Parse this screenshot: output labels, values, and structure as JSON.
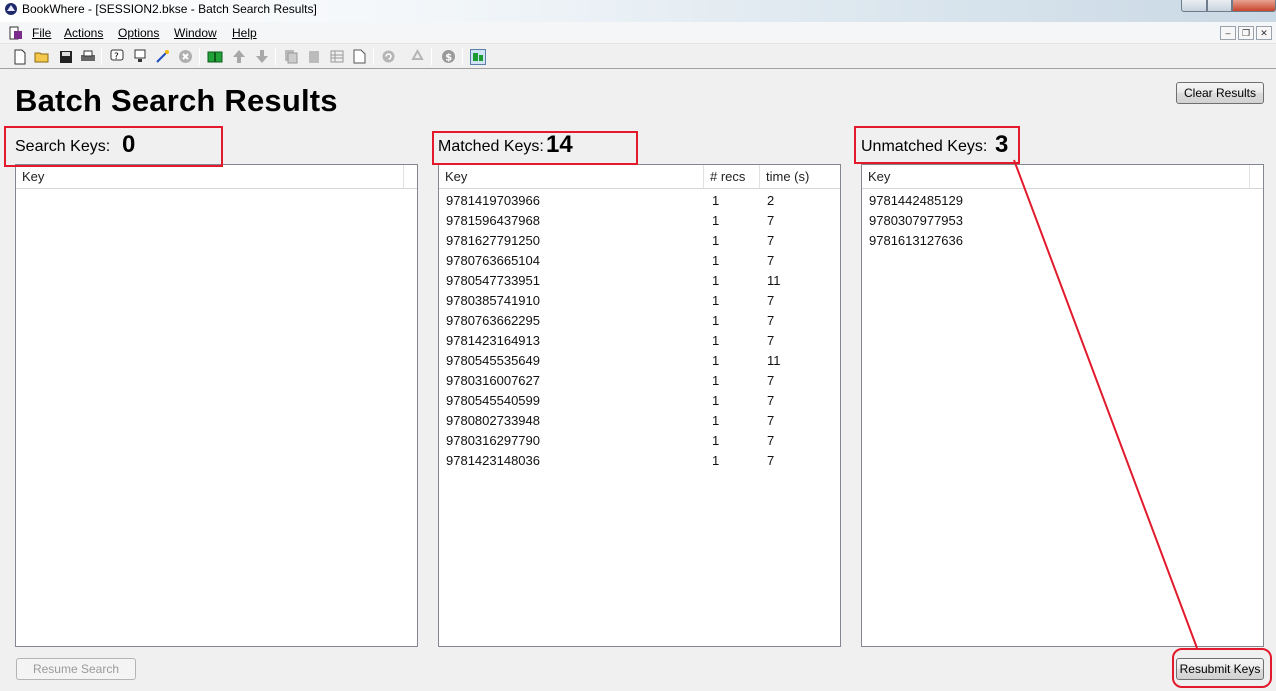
{
  "window": {
    "title": "BookWhere - [SESSION2.bkse - Batch Search Results]"
  },
  "menu": [
    "File",
    "Actions",
    "Options",
    "Window",
    "Help"
  ],
  "toolbar_icons": [
    "new-document-icon",
    "open-folder-icon",
    "save-disk-icon",
    "print-icon",
    "query-icon",
    "connect-icon",
    "wizard-icon",
    "stop-icon",
    "book-green-icon",
    "arrow-up-icon",
    "arrow-down-icon",
    "copy-record-icon",
    "paste-record-icon",
    "table-icon",
    "page-icon",
    "refresh-icon",
    "recycle-icon",
    "dollar-icon",
    "batch-search-icon"
  ],
  "page": {
    "title": "Batch Search Results",
    "clear_results_label": "Clear Results",
    "resume_search_label": "Resume Search",
    "resubmit_keys_label": "Resubmit Keys"
  },
  "search_keys": {
    "label": "Search Keys:",
    "count": "0",
    "columns": [
      "Key"
    ],
    "rows": []
  },
  "matched_keys": {
    "label": "Matched Keys:",
    "count": "14",
    "columns": [
      "Key",
      "# recs",
      "time (s)"
    ],
    "rows": [
      [
        "9781419703966",
        "1",
        "2"
      ],
      [
        "9781596437968",
        "1",
        "7"
      ],
      [
        "9781627791250",
        "1",
        "7"
      ],
      [
        "9780763665104",
        "1",
        "7"
      ],
      [
        "9780547733951",
        "1",
        "11"
      ],
      [
        "9780385741910",
        "1",
        "7"
      ],
      [
        "9780763662295",
        "1",
        "7"
      ],
      [
        "9781423164913",
        "1",
        "7"
      ],
      [
        "9780545535649",
        "1",
        "11"
      ],
      [
        "9780316007627",
        "1",
        "7"
      ],
      [
        "9780545540599",
        "1",
        "7"
      ],
      [
        "9780802733948",
        "1",
        "7"
      ],
      [
        "9780316297790",
        "1",
        "7"
      ],
      [
        "9781423148036",
        "1",
        "7"
      ]
    ]
  },
  "unmatched_keys": {
    "label": "Unmatched Keys:",
    "count": "3",
    "columns": [
      "Key"
    ],
    "rows": [
      [
        "9781442485129"
      ],
      [
        "9780307977953"
      ],
      [
        "9781613127636"
      ]
    ]
  },
  "colors": {
    "annotation_red": "#e21a2b",
    "panel_border": "#828790",
    "background": "#f0f0f0"
  }
}
